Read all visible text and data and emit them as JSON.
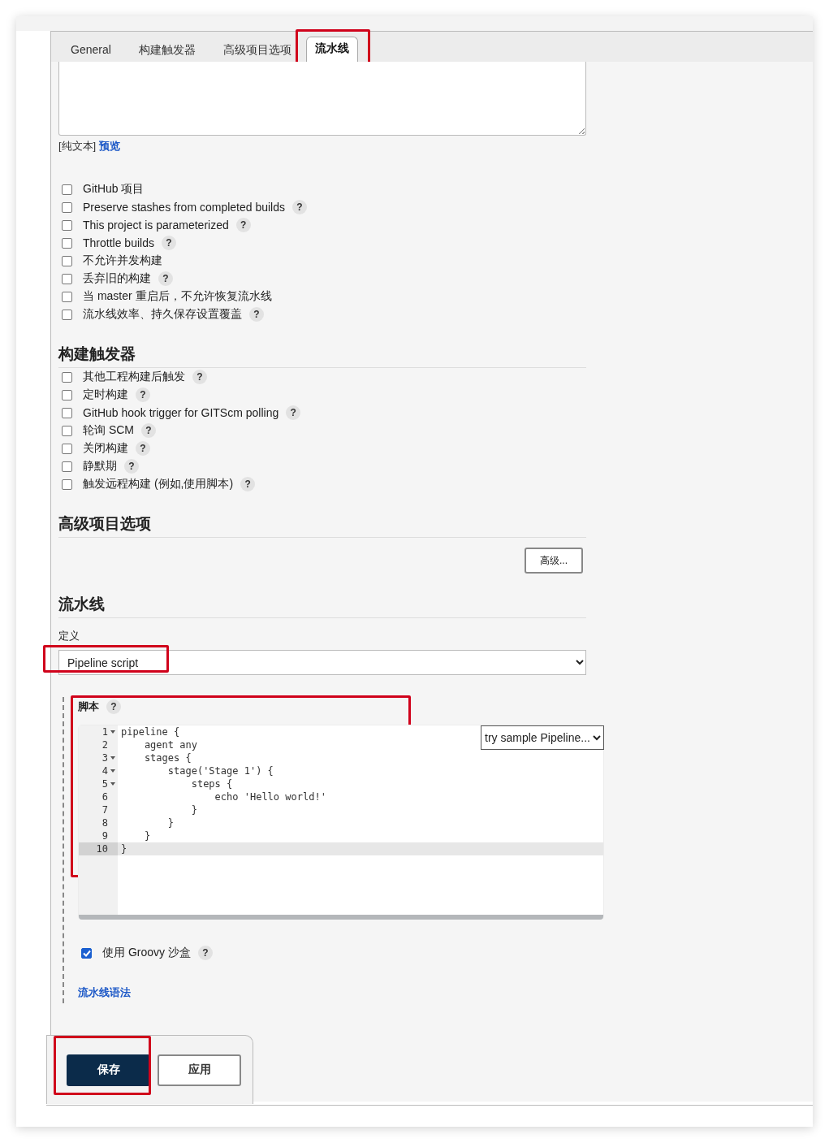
{
  "tabs": [
    {
      "label": "General",
      "selected": false,
      "highlighted": false
    },
    {
      "label": "构建触发器",
      "selected": false,
      "highlighted": false
    },
    {
      "label": "高级项目选项",
      "selected": false,
      "highlighted": false
    },
    {
      "label": "流水线",
      "selected": true,
      "highlighted": true
    }
  ],
  "description": {
    "format_label": "[纯文本]",
    "preview_link": "预览"
  },
  "general_options": [
    {
      "label": "GitHub 项目",
      "checked": false
    },
    {
      "label": "Preserve stashes from completed builds",
      "checked": false,
      "help": "?"
    },
    {
      "label": "This project is parameterized",
      "checked": false,
      "help": "?"
    },
    {
      "label": "Throttle builds",
      "checked": false,
      "help": "?"
    },
    {
      "label": "不允许并发构建",
      "checked": false
    },
    {
      "label": "丢弃旧的构建",
      "checked": false,
      "help": "?"
    },
    {
      "label": "当 master 重启后，不允许恢复流水线",
      "checked": false
    },
    {
      "label": "流水线效率、持久保存设置覆盖",
      "checked": false,
      "help": "?"
    }
  ],
  "triggers": {
    "heading": "构建触发器",
    "options": [
      {
        "label": "其他工程构建后触发",
        "checked": false,
        "help": "?"
      },
      {
        "label": "定时构建",
        "checked": false,
        "help": "?"
      },
      {
        "label": "GitHub hook trigger for GITScm polling",
        "checked": false,
        "help": "?"
      },
      {
        "label": "轮询 SCM",
        "checked": false,
        "help": "?"
      },
      {
        "label": "关闭构建",
        "checked": false,
        "help": "?"
      },
      {
        "label": "静默期",
        "checked": false,
        "help": "?"
      },
      {
        "label": "触发远程构建 (例如,使用脚本)",
        "checked": false,
        "help": "?"
      }
    ]
  },
  "advanced": {
    "heading": "高级项目选项",
    "button": "高级..."
  },
  "pipeline": {
    "heading": "流水线",
    "definition_label": "定义",
    "definition_value": "Pipeline script",
    "definition_highlighted": true,
    "script": {
      "label": "脚本",
      "help": "?",
      "highlighted": true,
      "sample_select": "try sample Pipeline...",
      "lines": [
        {
          "number": "1",
          "text": "pipeline {",
          "foldable": true,
          "selected": false
        },
        {
          "number": "2",
          "text": "    agent any",
          "foldable": false,
          "selected": false
        },
        {
          "number": "3",
          "text": "    stages {",
          "foldable": true,
          "selected": false
        },
        {
          "number": "4",
          "text": "        stage('Stage 1') {",
          "foldable": true,
          "selected": false
        },
        {
          "number": "5",
          "text": "            steps {",
          "foldable": true,
          "selected": false
        },
        {
          "number": "6",
          "text": "                echo 'Hello world!'",
          "foldable": false,
          "selected": false
        },
        {
          "number": "7",
          "text": "            }",
          "foldable": false,
          "selected": false
        },
        {
          "number": "8",
          "text": "        }",
          "foldable": false,
          "selected": false
        },
        {
          "number": "9",
          "text": "    }",
          "foldable": false,
          "selected": false
        },
        {
          "number": "10",
          "text": "}",
          "foldable": false,
          "selected": true
        }
      ]
    },
    "sandbox": {
      "label": "使用 Groovy 沙盒",
      "checked": true,
      "help": "?"
    },
    "syntax_link": "流水线语法"
  },
  "buttons": [
    {
      "label": "保存",
      "kind": "primary",
      "highlighted": true
    },
    {
      "label": "应用",
      "kind": "secondary",
      "highlighted": false
    }
  ]
}
